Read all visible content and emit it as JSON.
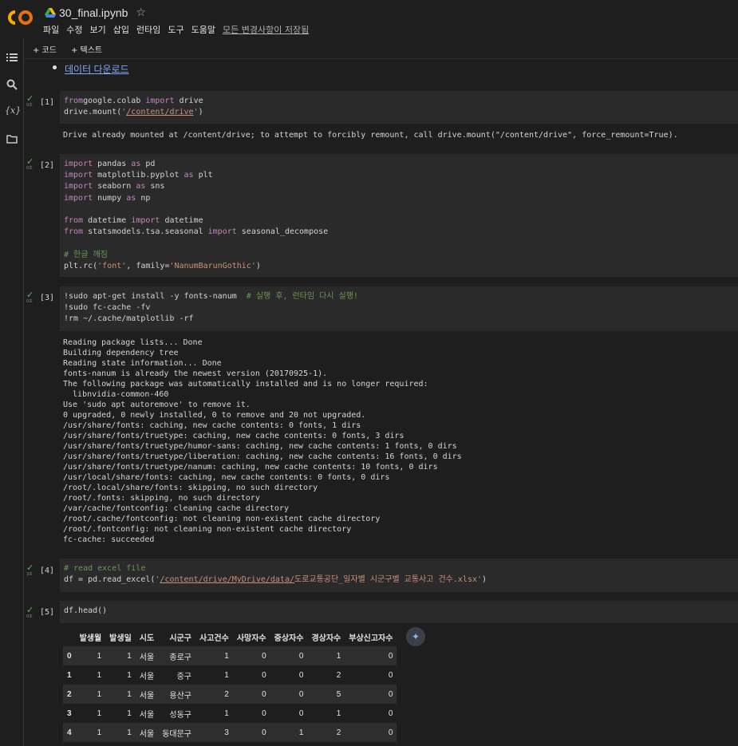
{
  "header": {
    "title": "30_final.ipynb",
    "menu": [
      "파일",
      "수정",
      "보기",
      "삽입",
      "런타임",
      "도구",
      "도움말"
    ],
    "saved_status": "모든 변경사항이 저장됨"
  },
  "toolbar": {
    "add_code": "+ 코드",
    "add_text": "+ 텍스트"
  },
  "link": "데이터 다운로드",
  "cells": [
    {
      "exec": "[1]",
      "time": "0초",
      "code_lines": [
        [
          [
            "kw",
            "from"
          ],
          [
            "",
            "google.colab"
          ],
          [
            "kw",
            " import "
          ],
          [
            "",
            "drive"
          ]
        ],
        [
          [
            "",
            "drive.mount("
          ],
          [
            "str",
            "'"
          ],
          [
            "str path",
            "/content/drive"
          ],
          [
            "str",
            "'"
          ],
          [
            "",
            ")"
          ]
        ]
      ],
      "output": "Drive already mounted at /content/drive; to attempt to forcibly remount, call drive.mount(\"/content/drive\", force_remount=True)."
    },
    {
      "exec": "[2]",
      "time": "0초",
      "code_lines": [
        [
          [
            "kw",
            "import"
          ],
          [
            "",
            " pandas "
          ],
          [
            "kw",
            "as"
          ],
          [
            "",
            " pd"
          ]
        ],
        [
          [
            "kw",
            "import"
          ],
          [
            "",
            " matplotlib.pyplot "
          ],
          [
            "kw",
            "as"
          ],
          [
            "",
            " plt"
          ]
        ],
        [
          [
            "kw",
            "import"
          ],
          [
            "",
            " seaborn "
          ],
          [
            "kw",
            "as"
          ],
          [
            "",
            " sns"
          ]
        ],
        [
          [
            "kw",
            "import"
          ],
          [
            "",
            " numpy "
          ],
          [
            "kw",
            "as"
          ],
          [
            "",
            " np"
          ]
        ],
        [],
        [
          [
            "kw",
            "from"
          ],
          [
            "",
            " datetime "
          ],
          [
            "kw",
            "import"
          ],
          [
            "",
            " datetime"
          ]
        ],
        [
          [
            "kw",
            "from"
          ],
          [
            "",
            " statsmodels.tsa.seasonal "
          ],
          [
            "kw",
            "import"
          ],
          [
            "",
            " seasonal_decompose"
          ]
        ],
        [],
        [
          [
            "cmt",
            "# 한글 깨짐"
          ]
        ],
        [
          [
            "",
            "plt.rc("
          ],
          [
            "str",
            "'font'"
          ],
          [
            "",
            ", family="
          ],
          [
            "str",
            "'NanumBarunGothic'"
          ],
          [
            "",
            ")"
          ]
        ]
      ]
    },
    {
      "exec": "[3]",
      "time": "0초",
      "code_lines": [
        [
          [
            "",
            "!sudo apt-get install -y fonts-nanum  "
          ],
          [
            "cmt",
            "# 실행 후, 런타임 다시 실행!"
          ]
        ],
        [
          [
            "",
            "!sudo fc-cache -fv"
          ]
        ],
        [
          [
            "",
            "!rm ~/.cache/matplotlib -rf"
          ]
        ]
      ],
      "output": "Reading package lists... Done\nBuilding dependency tree\nReading state information... Done\nfonts-nanum is already the newest version (20170925-1).\nThe following package was automatically installed and is no longer required:\n  libnvidia-common-460\nUse 'sudo apt autoremove' to remove it.\n0 upgraded, 0 newly installed, 0 to remove and 20 not upgraded.\n/usr/share/fonts: caching, new cache contents: 0 fonts, 1 dirs\n/usr/share/fonts/truetype: caching, new cache contents: 0 fonts, 3 dirs\n/usr/share/fonts/truetype/humor-sans: caching, new cache contents: 1 fonts, 0 dirs\n/usr/share/fonts/truetype/liberation: caching, new cache contents: 16 fonts, 0 dirs\n/usr/share/fonts/truetype/nanum: caching, new cache contents: 10 fonts, 0 dirs\n/usr/local/share/fonts: caching, new cache contents: 0 fonts, 0 dirs\n/root/.local/share/fonts: skipping, no such directory\n/root/.fonts: skipping, no such directory\n/var/cache/fontconfig: cleaning cache directory\n/root/.cache/fontconfig: not cleaning non-existent cache directory\n/root/.fontconfig: not cleaning non-existent cache directory\nfc-cache: succeeded"
    },
    {
      "exec": "[4]",
      "time": "3초",
      "code_lines": [
        [
          [
            "cmt",
            "# read excel file"
          ]
        ],
        [
          [
            "",
            "df = pd.read_excel("
          ],
          [
            "str",
            "'"
          ],
          [
            "str path",
            "/content/drive/MyDrive/data/"
          ],
          [
            "str",
            "도로교통공단_일자별 시군구별 교통사고 건수.xlsx'"
          ],
          [
            "",
            ")"
          ]
        ]
      ]
    },
    {
      "exec": "[5]",
      "time": "0초",
      "code_lines": [
        [
          [
            "",
            "df.head()"
          ]
        ]
      ]
    }
  ],
  "table": {
    "columns": [
      "",
      "발생월",
      "발생일",
      "시도",
      "시군구",
      "사고건수",
      "사망자수",
      "중상자수",
      "경상자수",
      "부상신고자수"
    ],
    "rows": [
      [
        "0",
        "1",
        "1",
        "서울",
        "종로구",
        "1",
        "0",
        "0",
        "1",
        "0"
      ],
      [
        "1",
        "1",
        "1",
        "서울",
        "중구",
        "1",
        "0",
        "0",
        "2",
        "0"
      ],
      [
        "2",
        "1",
        "1",
        "서울",
        "용산구",
        "2",
        "0",
        "0",
        "5",
        "0"
      ],
      [
        "3",
        "1",
        "1",
        "서울",
        "성동구",
        "1",
        "0",
        "0",
        "1",
        "0"
      ],
      [
        "4",
        "1",
        "1",
        "서울",
        "동대문구",
        "3",
        "0",
        "1",
        "2",
        "0"
      ]
    ]
  },
  "colors": {
    "keyword": "#c586c0",
    "string": "#ce9178",
    "comment": "#6a9955",
    "link": "#7cacf8",
    "check": "#5fb85f"
  }
}
